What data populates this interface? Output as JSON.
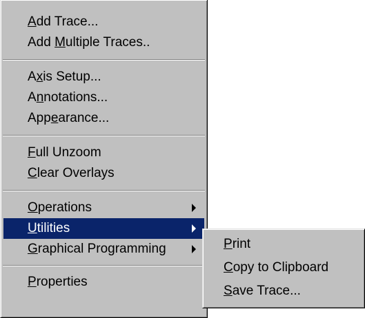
{
  "menu": {
    "groups": [
      [
        {
          "pre": "",
          "key": "A",
          "post": "dd Trace..."
        },
        {
          "pre": "Add ",
          "key": "M",
          "post": "ultiple Traces.."
        }
      ],
      [
        {
          "pre": "A",
          "key": "x",
          "post": "is Setup..."
        },
        {
          "pre": "A",
          "key": "n",
          "post": "notations..."
        },
        {
          "pre": "App",
          "key": "e",
          "post": "arance..."
        }
      ],
      [
        {
          "pre": "",
          "key": "F",
          "post": "ull Unzoom"
        },
        {
          "pre": "",
          "key": "C",
          "post": "lear Overlays"
        }
      ],
      [
        {
          "pre": "",
          "key": "O",
          "post": "perations",
          "submenu": true
        },
        {
          "pre": "",
          "key": "U",
          "post": "tilities",
          "submenu": true,
          "selected": true
        },
        {
          "pre": "",
          "key": "G",
          "post": "raphical Programming",
          "submenu": true
        }
      ],
      [
        {
          "pre": "",
          "key": "P",
          "post": "roperties"
        }
      ]
    ]
  },
  "submenu": {
    "items": [
      {
        "pre": "",
        "key": "P",
        "post": "rint"
      },
      {
        "pre": "",
        "key": "C",
        "post": "opy to Clipboard"
      },
      {
        "pre": "",
        "key": "S",
        "post": "ave Trace..."
      }
    ]
  },
  "colors": {
    "menu_bg": "#c0c0c0",
    "selection_bg": "#0a246a",
    "selection_fg": "#ffffff",
    "text": "#000000"
  }
}
